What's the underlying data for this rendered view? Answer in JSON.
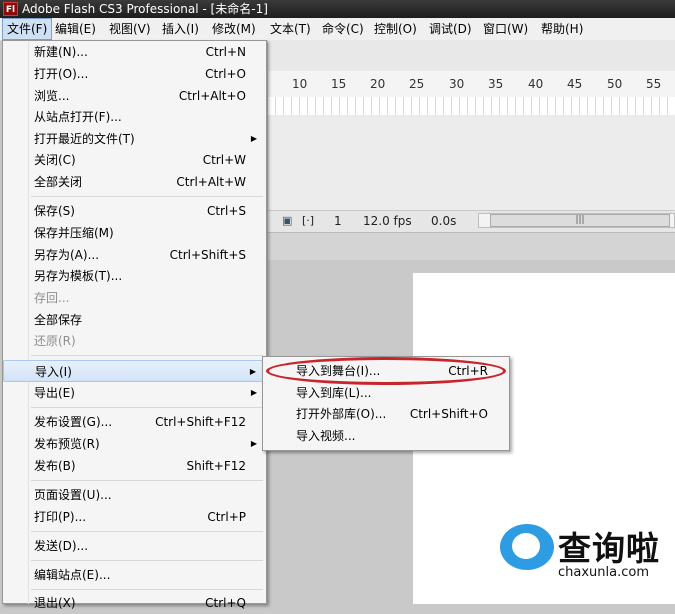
{
  "window": {
    "app_icon": "Fl",
    "title": "Adobe Flash CS3 Professional - [未命名-1]"
  },
  "menubar": [
    {
      "label": "文件(F)",
      "active": true
    },
    {
      "label": "编辑(E)"
    },
    {
      "label": "视图(V)"
    },
    {
      "label": "插入(I)"
    },
    {
      "label": "修改(M)"
    },
    {
      "label": "文本(T)"
    },
    {
      "label": "命令(C)"
    },
    {
      "label": "控制(O)"
    },
    {
      "label": "调试(D)"
    },
    {
      "label": "窗口(W)"
    },
    {
      "label": "帮助(H)"
    }
  ],
  "timeline": {
    "ruler": [
      "10",
      "15",
      "20",
      "25",
      "30",
      "35",
      "40",
      "45",
      "50",
      "55"
    ],
    "status": {
      "frame": "1",
      "fps": "12.0 fps",
      "time": "0.0s"
    }
  },
  "file_menu": [
    {
      "label": "新建(N)...",
      "shortcut": "Ctrl+N"
    },
    {
      "label": "打开(O)...",
      "shortcut": "Ctrl+O"
    },
    {
      "label": "浏览...",
      "shortcut": "Ctrl+Alt+O"
    },
    {
      "label": "从站点打开(F)...",
      "shortcut": ""
    },
    {
      "label": "打开最近的文件(T)",
      "shortcut": "",
      "submenu": true
    },
    {
      "label": "关闭(C)",
      "shortcut": "Ctrl+W"
    },
    {
      "label": "全部关闭",
      "shortcut": "Ctrl+Alt+W"
    },
    {
      "label": "保存(S)",
      "shortcut": "Ctrl+S"
    },
    {
      "label": "保存并压缩(M)",
      "shortcut": ""
    },
    {
      "label": "另存为(A)...",
      "shortcut": "Ctrl+Shift+S"
    },
    {
      "label": "另存为模板(T)...",
      "shortcut": ""
    },
    {
      "label": "存回...",
      "shortcut": "",
      "disabled": true
    },
    {
      "label": "全部保存",
      "shortcut": ""
    },
    {
      "label": "还原(R)",
      "shortcut": "",
      "disabled": true
    },
    {
      "label": "导入(I)",
      "shortcut": "",
      "submenu": true,
      "highlighted": true
    },
    {
      "label": "导出(E)",
      "shortcut": "",
      "submenu": true
    },
    {
      "label": "发布设置(G)...",
      "shortcut": "Ctrl+Shift+F12"
    },
    {
      "label": "发布预览(R)",
      "shortcut": "",
      "submenu": true
    },
    {
      "label": "发布(B)",
      "shortcut": "Shift+F12"
    },
    {
      "label": "页面设置(U)...",
      "shortcut": ""
    },
    {
      "label": "打印(P)...",
      "shortcut": "Ctrl+P"
    },
    {
      "label": "发送(D)...",
      "shortcut": ""
    },
    {
      "label": "编辑站点(E)...",
      "shortcut": ""
    },
    {
      "label": "退出(X)",
      "shortcut": "Ctrl+Q"
    }
  ],
  "import_submenu": [
    {
      "label": "导入到舞台(I)...",
      "shortcut": "Ctrl+R",
      "circled": true
    },
    {
      "label": "导入到库(L)...",
      "shortcut": ""
    },
    {
      "label": "打开外部库(O)...",
      "shortcut": "Ctrl+Shift+O"
    },
    {
      "label": "导入视频...",
      "shortcut": ""
    }
  ],
  "watermark": {
    "brand": "查询啦",
    "domain": "chaxunla.com"
  },
  "colors": {
    "highlight_ring": "#c8242c",
    "menu_bg": "#f5f5f5",
    "watermark_blue": "#2d9ce3"
  },
  "icons": [
    "app-flash-icon",
    "submenu-arrow-icon",
    "watermark-q-icon"
  ]
}
